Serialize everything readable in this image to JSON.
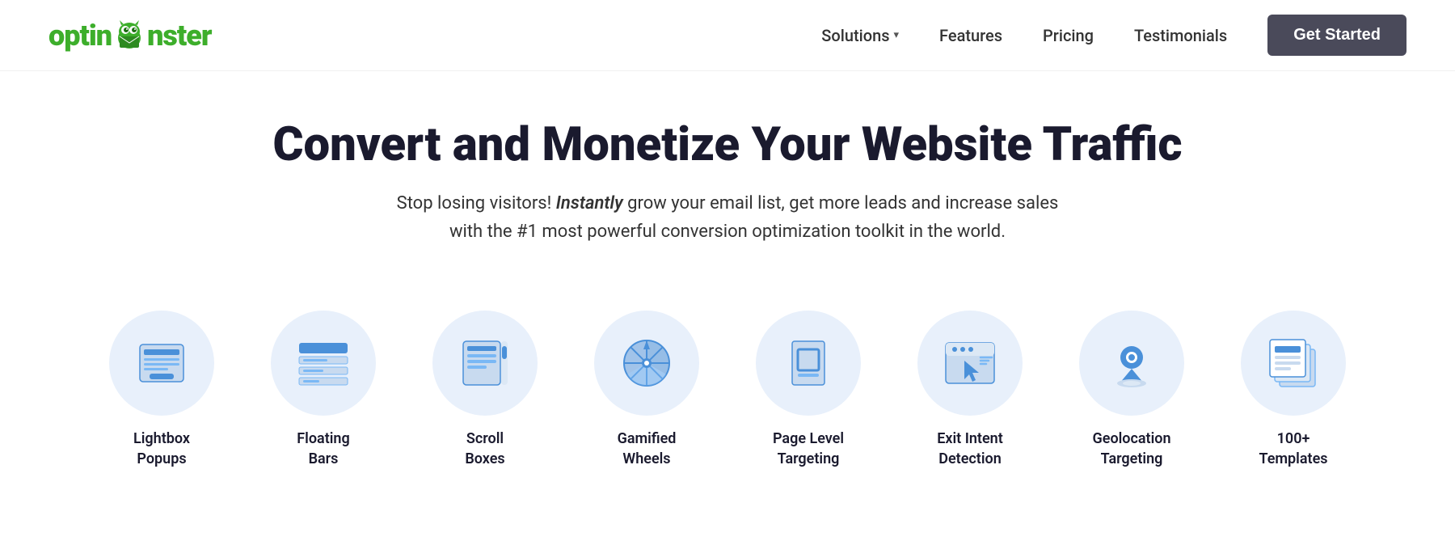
{
  "header": {
    "logo_text_before": "optin",
    "logo_text_after": "nster",
    "nav_items": [
      {
        "label": "Solutions",
        "has_dropdown": true
      },
      {
        "label": "Features",
        "has_dropdown": false
      },
      {
        "label": "Pricing",
        "has_dropdown": false
      },
      {
        "label": "Testimonials",
        "has_dropdown": false
      }
    ],
    "cta_button": "Get Started"
  },
  "hero": {
    "title": "Convert and Monetize Your Website Traffic",
    "subtitle_plain": "Stop losing visitors! ",
    "subtitle_italic": "Instantly",
    "subtitle_rest": " grow your email list, get more leads and increase sales with the #1 most powerful conversion optimization toolkit in the world."
  },
  "features": [
    {
      "id": "lightbox",
      "label_line1": "Lightbox",
      "label_line2": "Popups",
      "icon": "lightbox"
    },
    {
      "id": "floating",
      "label_line1": "Floating",
      "label_line2": "Bars",
      "icon": "floating"
    },
    {
      "id": "scroll",
      "label_line1": "Scroll",
      "label_line2": "Boxes",
      "icon": "scroll"
    },
    {
      "id": "gamified",
      "label_line1": "Gamified",
      "label_line2": "Wheels",
      "icon": "gamified"
    },
    {
      "id": "page-level",
      "label_line1": "Page Level",
      "label_line2": "Targeting",
      "icon": "page-level"
    },
    {
      "id": "exit-intent",
      "label_line1": "Exit Intent",
      "label_line2": "Detection",
      "icon": "exit-intent"
    },
    {
      "id": "geolocation",
      "label_line1": "Geolocation",
      "label_line2": "Targeting",
      "icon": "geolocation"
    },
    {
      "id": "templates",
      "label_line1": "100+",
      "label_line2": "Templates",
      "icon": "templates"
    }
  ],
  "colors": {
    "icon_bg": "#e8f0fb",
    "icon_primary": "#4a90d9",
    "icon_secondary": "#7ab8f5",
    "logo_green": "#3dae2b",
    "nav_text": "#333333",
    "hero_title": "#1a1a2e",
    "cta_bg": "#4a4a5a",
    "cta_text": "#ffffff"
  }
}
